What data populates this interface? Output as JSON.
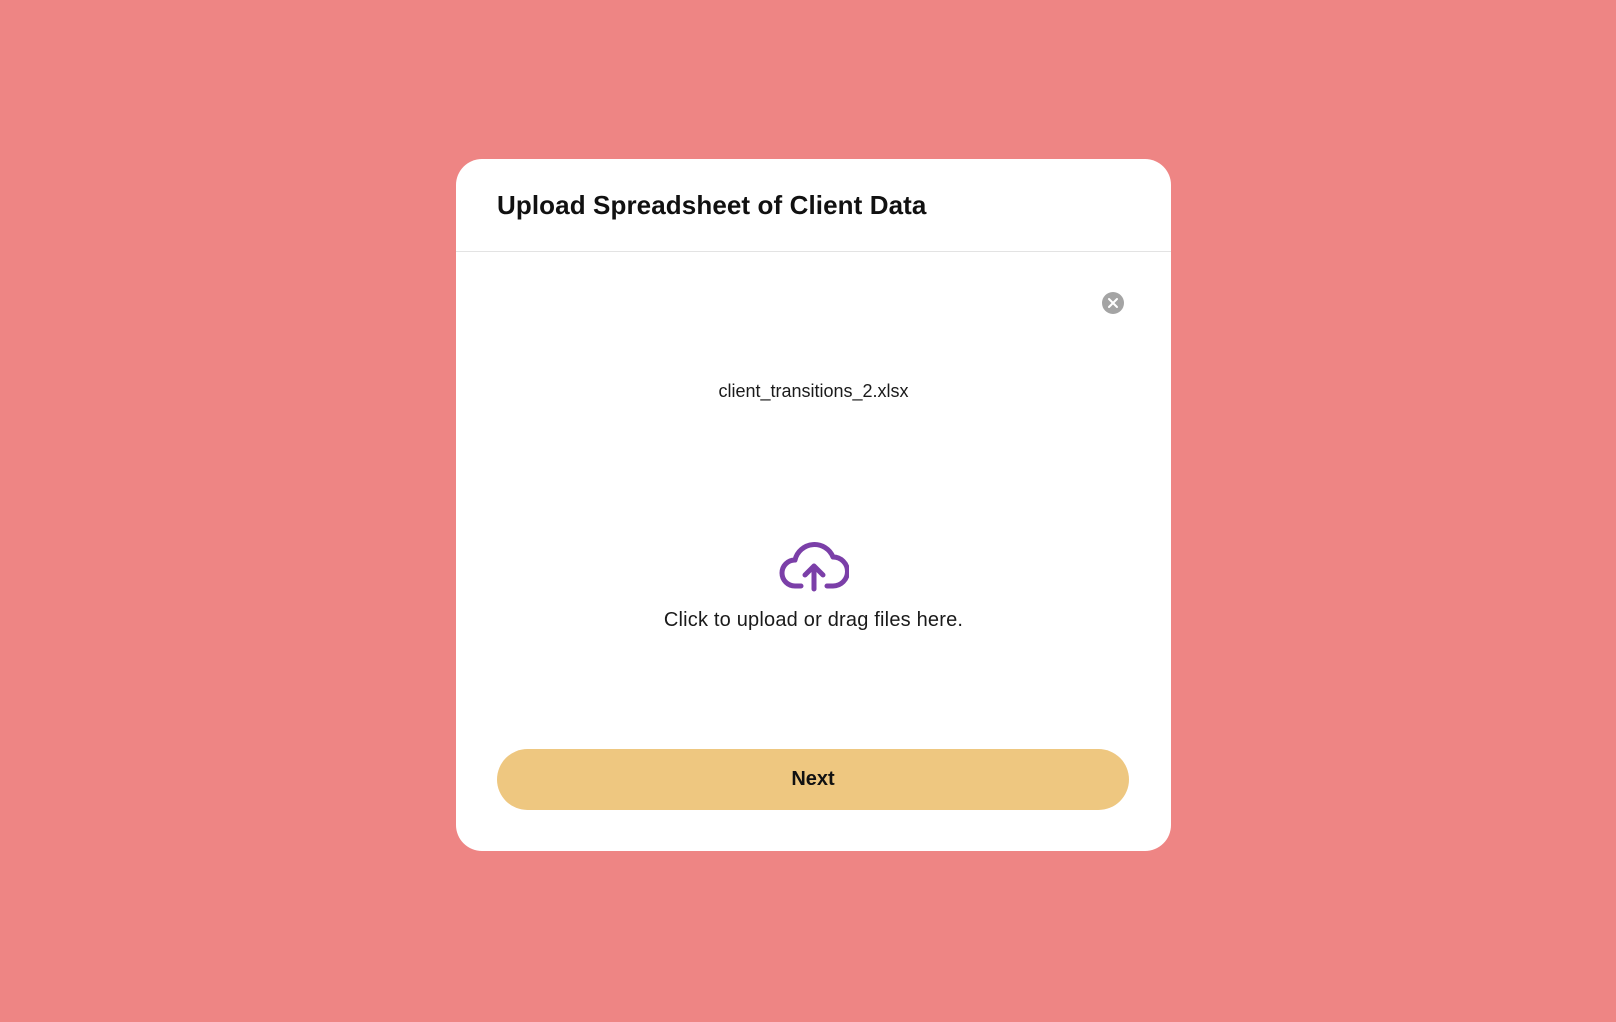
{
  "modal": {
    "title": "Upload Spreadsheet of Client Data",
    "remove_icon": "close-circle-icon",
    "file_name": "client_transitions_2.xlsx",
    "dropzone": {
      "icon": "cloud-upload-icon",
      "text": "Click to upload or drag files here."
    },
    "next_label": "Next"
  },
  "colors": {
    "background": "#ee8584",
    "card": "#ffffff",
    "accent_icon": "#7b3fa8",
    "button": "#eec780",
    "remove_icon": "#a4a4a4"
  }
}
